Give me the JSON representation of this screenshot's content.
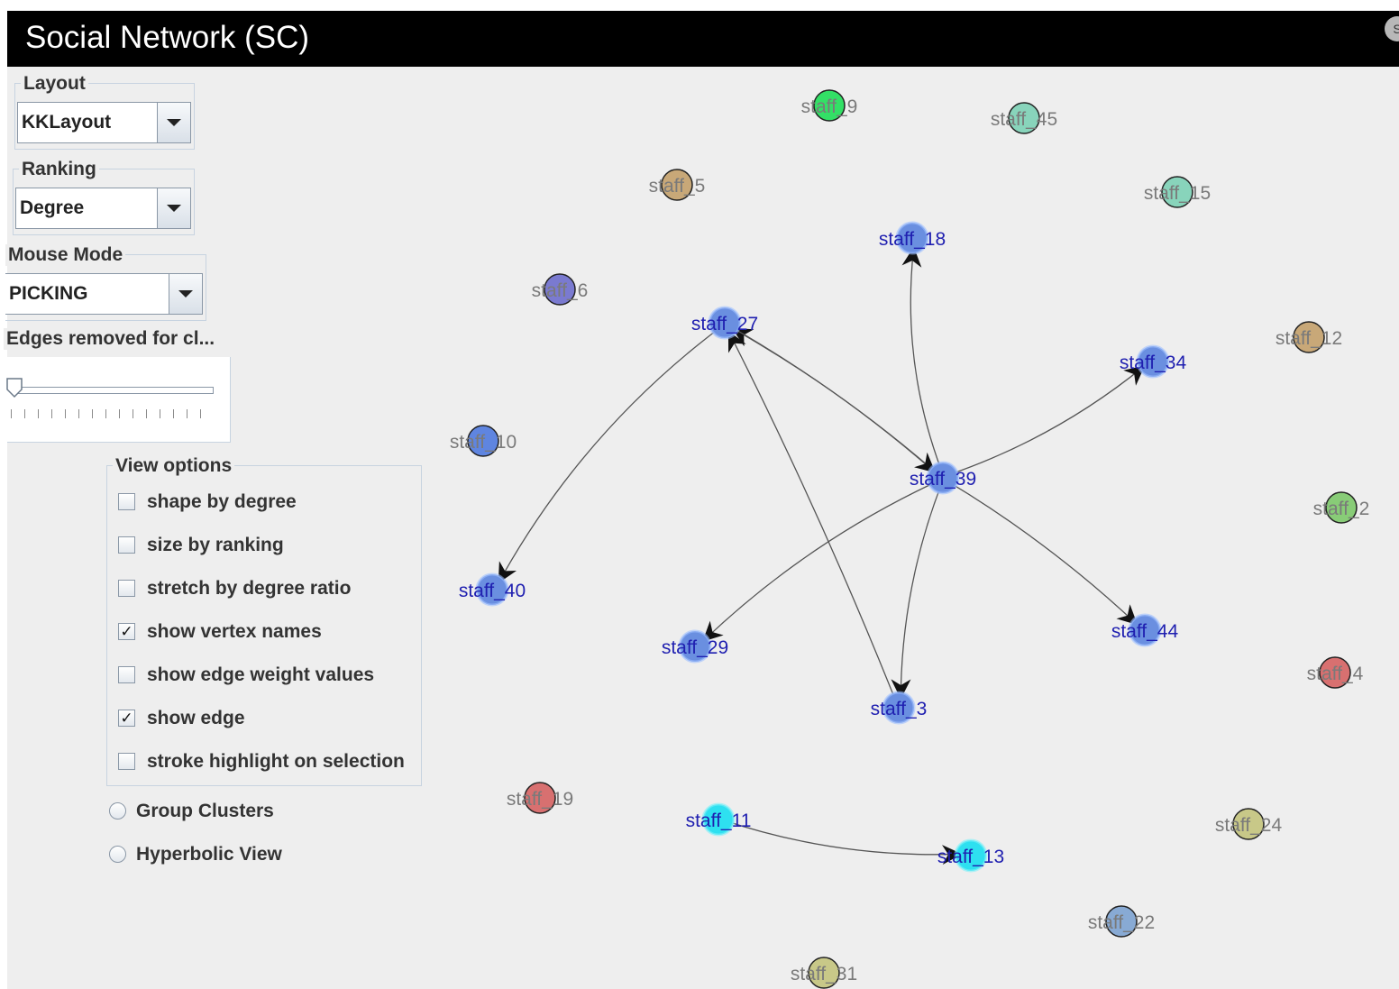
{
  "window": {
    "title": "Social Network (SC)",
    "corner_glyph": "S"
  },
  "controls": {
    "layout": {
      "label": "Layout",
      "selected": "KKLayout"
    },
    "ranking": {
      "label": "Ranking",
      "selected": "Degree"
    },
    "mouse_mode": {
      "label": "Mouse Mode",
      "selected": "PICKING"
    },
    "edges_removed": {
      "label": "Edges removed for cl...",
      "value": 0
    }
  },
  "view_options": {
    "label": "View options",
    "items": [
      {
        "label": "shape by degree",
        "checked": false
      },
      {
        "label": "size by ranking",
        "checked": false
      },
      {
        "label": "stretch by degree ratio",
        "checked": false
      },
      {
        "label": "show vertex names",
        "checked": true
      },
      {
        "label": "show edge weight values",
        "checked": false
      },
      {
        "label": "show edge",
        "checked": true
      },
      {
        "label": "stroke highlight on selection",
        "checked": false
      }
    ]
  },
  "radios": {
    "group_clusters": "Group Clusters",
    "hyperbolic_view": "Hyperbolic View"
  },
  "graph": {
    "colors": {
      "connected_vertex": "#6a8fe0",
      "connected_label": "#1f1fb0",
      "cyan_vertex": "#2ee0f0",
      "gray_label": "#7a7a7a",
      "edge": "#555555"
    },
    "vertices": [
      {
        "id": "staff_9",
        "label": "staff_9",
        "color": "#33e066",
        "style": "isolated"
      },
      {
        "id": "staff_45",
        "label": "staff_45",
        "color": "#88d4bb",
        "style": "isolated"
      },
      {
        "id": "staff_5",
        "label": "staff_5",
        "color": "#c8a878",
        "style": "isolated"
      },
      {
        "id": "staff_15",
        "label": "staff_15",
        "color": "#88d4bb",
        "style": "isolated"
      },
      {
        "id": "staff_18",
        "label": "staff_18",
        "color": "#6a8fe0",
        "style": "connected"
      },
      {
        "id": "staff_6",
        "label": "staff_6",
        "color": "#7a7ad0",
        "style": "isolated"
      },
      {
        "id": "staff_27",
        "label": "staff_27",
        "color": "#6a8fe0",
        "style": "connected"
      },
      {
        "id": "staff_12",
        "label": "staff_12",
        "color": "#c8a878",
        "style": "isolated"
      },
      {
        "id": "staff_34",
        "label": "staff_34",
        "color": "#6a8fe0",
        "style": "connected"
      },
      {
        "id": "staff_10",
        "label": "staff_10",
        "color": "#5f85e0",
        "style": "isolated"
      },
      {
        "id": "staff_39",
        "label": "staff_39",
        "color": "#6a8fe0",
        "style": "connected"
      },
      {
        "id": "staff_2",
        "label": "staff_2",
        "color": "#88cc77",
        "style": "isolated"
      },
      {
        "id": "staff_40",
        "label": "staff_40",
        "color": "#6a8fe0",
        "style": "connected"
      },
      {
        "id": "staff_29",
        "label": "staff_29",
        "color": "#6a8fe0",
        "style": "connected"
      },
      {
        "id": "staff_44",
        "label": "staff_44",
        "color": "#6a8fe0",
        "style": "connected"
      },
      {
        "id": "staff_4",
        "label": "staff_4",
        "color": "#d87070",
        "style": "isolated"
      },
      {
        "id": "staff_3",
        "label": "staff_3",
        "color": "#6a8fe0",
        "style": "connected"
      },
      {
        "id": "staff_19",
        "label": "staff_19",
        "color": "#d87070",
        "style": "isolated"
      },
      {
        "id": "staff_11",
        "label": "staff_11",
        "color": "#2ee0f0",
        "style": "connected"
      },
      {
        "id": "staff_24",
        "label": "staff_24",
        "color": "#c8c888",
        "style": "isolated"
      },
      {
        "id": "staff_13",
        "label": "staff_13",
        "color": "#2ee0f0",
        "style": "connected"
      },
      {
        "id": "staff_22",
        "label": "staff_22",
        "color": "#88aad4",
        "style": "isolated"
      },
      {
        "id": "staff_31",
        "label": "staff_31",
        "color": "#c8c888",
        "style": "isolated"
      }
    ],
    "edges": [
      {
        "from": "staff_39",
        "to": "staff_18"
      },
      {
        "from": "staff_39",
        "to": "staff_27"
      },
      {
        "from": "staff_27",
        "to": "staff_39"
      },
      {
        "from": "staff_39",
        "to": "staff_34"
      },
      {
        "from": "staff_27",
        "to": "staff_40"
      },
      {
        "from": "staff_39",
        "to": "staff_29"
      },
      {
        "from": "staff_39",
        "to": "staff_44"
      },
      {
        "from": "staff_39",
        "to": "staff_3"
      },
      {
        "from": "staff_3",
        "to": "staff_27"
      },
      {
        "from": "staff_11",
        "to": "staff_13"
      }
    ]
  }
}
